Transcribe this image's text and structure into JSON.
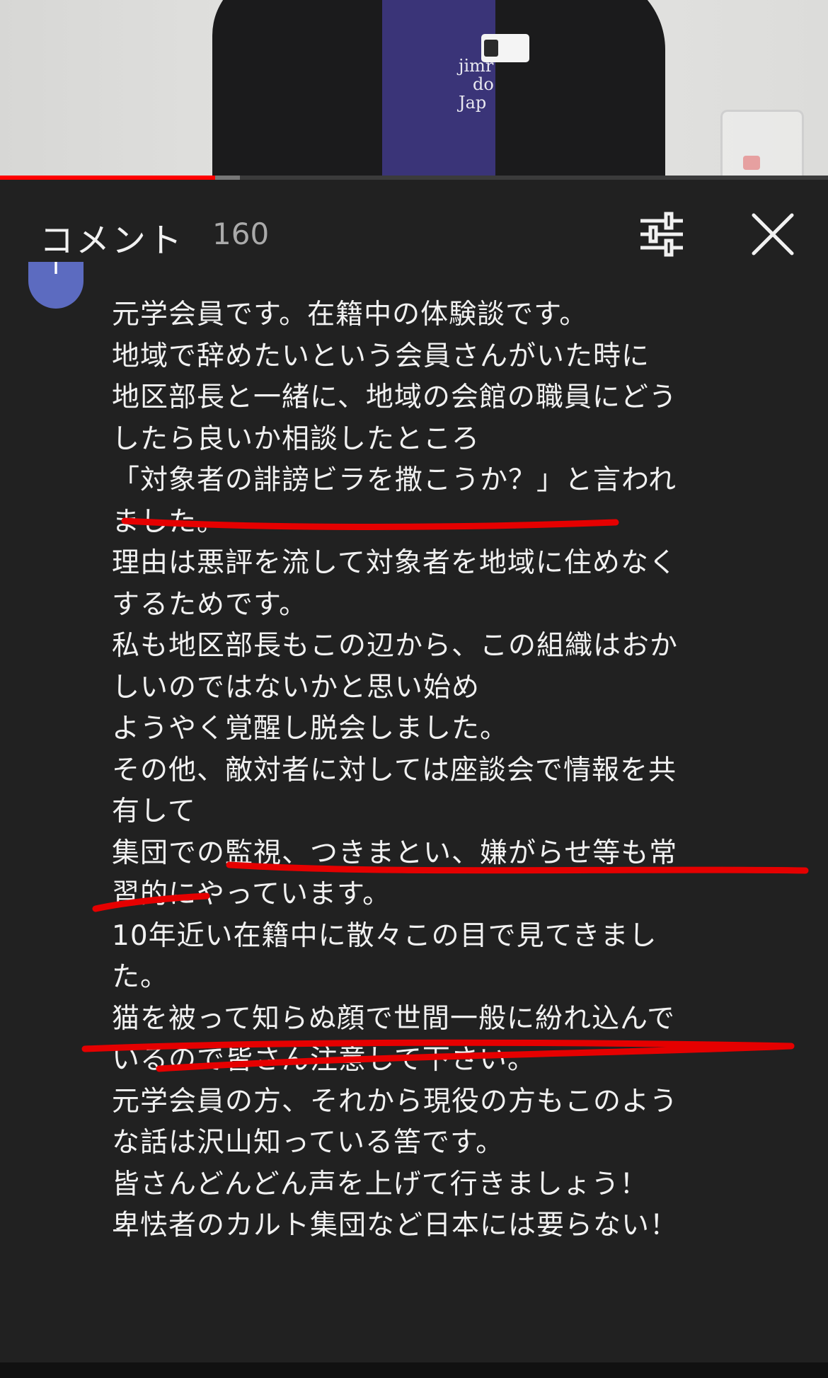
{
  "video": {
    "shirt_text": [
      "jimr",
      "do",
      "Jap"
    ],
    "progress": {
      "played_fraction": 0.26,
      "buffered_fraction": 0.29
    }
  },
  "header": {
    "title": "コメント",
    "count": "160",
    "filter_icon": "sliders-icon",
    "close_icon": "close-icon"
  },
  "comment": {
    "avatar_letter": "T",
    "avatar_color": "#5c6bc0",
    "lines": [
      "元学会員です。在籍中の体験談です。",
      "地域で辞めたいという会員さんがいた時に",
      "地区部長と一緒に、地域の会館の職員にどう",
      "したら良いか相談したところ",
      "「対象者の誹謗ビラを撒こうか？」と言われ",
      "ました。",
      "理由は悪評を流して対象者を地域に住めなく",
      "するためです。",
      "私も地区部長もこの辺から、この組織はおか",
      "しいのではないかと思い始め",
      "ようやく覚醒し脱会しました。",
      "その他、敵対者に対しては座談会で情報を共",
      "有して",
      "集団での監視、つきまとい、嫌がらせ等も常",
      "習的にやっています。",
      "10年近い在籍中に散々この目で見てきまし",
      "た。",
      "猫を被って知らぬ顔で世間一般に紛れ込んで",
      "いるので皆さん注意して下さい。",
      "元学会員の方、それから現役の方もこのよう",
      "な話は沢山知っている筈です。",
      "皆さんどんどん声を上げて行きましょう！",
      "卑怯者のカルト集団など日本には要らない！"
    ]
  },
  "colors": {
    "background": "#212121",
    "text": "#f1f1f1",
    "muted": "#aaaaaa",
    "progress": "#ff0000",
    "annotation": "#e50000"
  }
}
